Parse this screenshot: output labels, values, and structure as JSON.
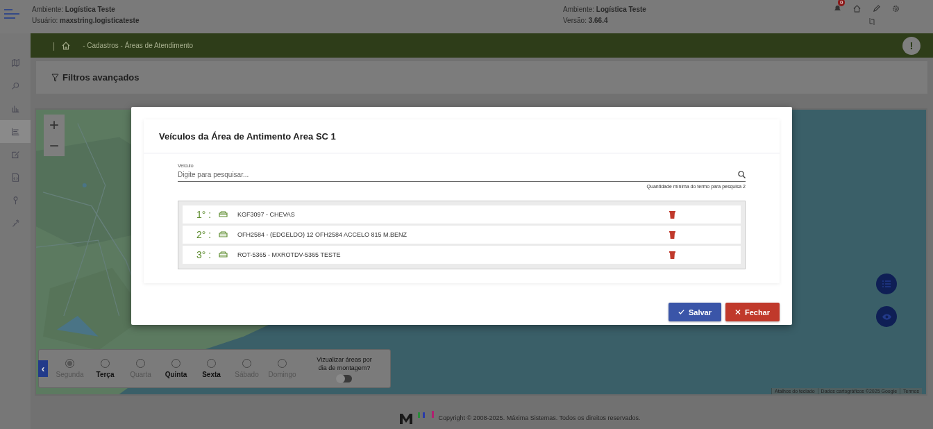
{
  "header": {
    "left_lines": [
      "Ambiente: **Logística Teste**",
      "Usuário: **maxstring.logisticateste**"
    ],
    "right_lines": [
      "Ambiente: **Logística Teste**",
      "Versão: **3.66.4**"
    ],
    "notification_badge": "0"
  },
  "sidebar": {
    "items": [
      {
        "kind": "map",
        "selected": false
      },
      {
        "kind": "search",
        "selected": false
      },
      {
        "kind": "chart",
        "selected": false
      },
      {
        "kind": "list",
        "selected": true
      },
      {
        "kind": "edit",
        "selected": false
      },
      {
        "kind": "document",
        "selected": false
      },
      {
        "kind": "pin",
        "selected": false
      },
      {
        "kind": "tools",
        "selected": false
      }
    ]
  },
  "breadcrumb": {
    "separator": "|",
    "path": "- Cadastros - Áreas de Atendimento",
    "alert": "!"
  },
  "filters": {
    "title": "Filtros avançados"
  },
  "map": {
    "zoom_in": "+",
    "zoom_out": "−",
    "collapse": "‹",
    "days": [
      {
        "label": "Segunda",
        "selected": true,
        "disabled": true
      },
      {
        "label": "Terça",
        "selected": false,
        "disabled": false
      },
      {
        "label": "Quarta",
        "selected": false,
        "disabled": true
      },
      {
        "label": "Quinta",
        "selected": false,
        "disabled": false
      },
      {
        "label": "Sexta",
        "selected": false,
        "disabled": false
      },
      {
        "label": "Sábado",
        "selected": false,
        "disabled": true
      },
      {
        "label": "Domingo",
        "selected": false,
        "disabled": true
      }
    ],
    "toggle": {
      "label": "Vizualizar áreas por dia de montagem?",
      "on": false
    },
    "attribution": [
      "Atalhos do teclado",
      "Dados cartográficos ©2025 Google",
      "Termos"
    ]
  },
  "modal": {
    "title": "Veículos da Área de Antimento Area SC 1",
    "search": {
      "label": "Veiculo",
      "placeholder": "Digite para pesquisar...",
      "hint": "Quantidade mínima do termo para pesquisa 2"
    },
    "vehicles": [
      {
        "position": "1° :",
        "name": "KGF3097 - CHEVAS"
      },
      {
        "position": "2° :",
        "name": "OFH2584 - (EDGELDO) 12 OFH2584 ACCELO 815 M.BENZ"
      },
      {
        "position": "3° :",
        "name": "ROT-5365 - MXROTDV-5365 TESTE"
      }
    ],
    "buttons": [
      {
        "kind": "save",
        "label": "Salvar"
      },
      {
        "kind": "close",
        "label": "Fechar"
      }
    ]
  },
  "footer": {
    "copyright": "Copyright © 2008-2025. Máxima Sistemas. Todos os direitos reservados."
  }
}
